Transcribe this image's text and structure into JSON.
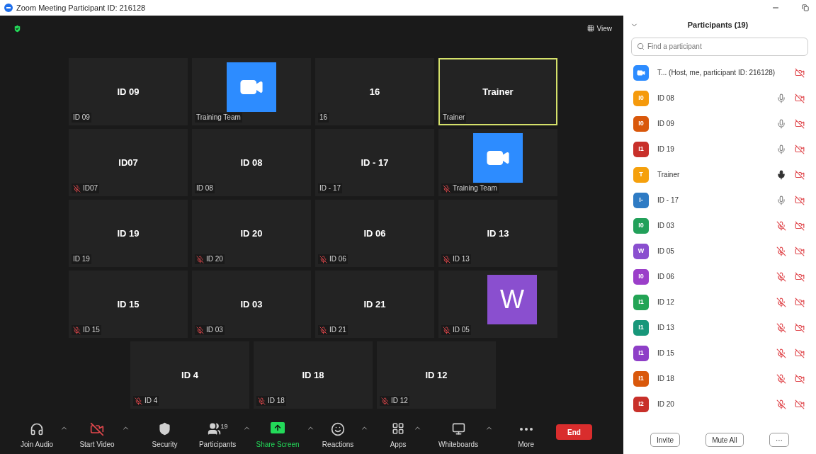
{
  "window": {
    "title": "Zoom Meeting Participant ID: 216128"
  },
  "view_button": {
    "label": "View"
  },
  "tiles": [
    {
      "kind": "name",
      "big": "ID 09",
      "label": "ID 09",
      "muted": false,
      "speaking": false
    },
    {
      "kind": "video_logo",
      "label": "Training Team",
      "muted": false,
      "speaking": false
    },
    {
      "kind": "name",
      "big": "16",
      "label": "16",
      "muted": false,
      "speaking": false
    },
    {
      "kind": "name",
      "big": "Trainer",
      "label": "Trainer",
      "muted": false,
      "speaking": true
    },
    {
      "kind": "name",
      "big": "ID07",
      "label": "ID07",
      "muted": true,
      "speaking": false
    },
    {
      "kind": "name",
      "big": "ID 08",
      "label": "ID 08",
      "muted": false,
      "speaking": false
    },
    {
      "kind": "name",
      "big": "ID - 17",
      "label": "ID - 17",
      "muted": false,
      "speaking": false
    },
    {
      "kind": "video_logo",
      "label": "Training Team",
      "muted": true,
      "speaking": false
    },
    {
      "kind": "name",
      "big": "ID 19",
      "label": "ID 19",
      "muted": false,
      "speaking": false
    },
    {
      "kind": "name",
      "big": "ID 20",
      "label": "ID 20",
      "muted": true,
      "speaking": false
    },
    {
      "kind": "name",
      "big": "ID 06",
      "label": "ID 06",
      "muted": true,
      "speaking": false
    },
    {
      "kind": "name",
      "big": "ID 13",
      "label": "ID 13",
      "muted": true,
      "speaking": false
    },
    {
      "kind": "name",
      "big": "ID 15",
      "label": "ID 15",
      "muted": true,
      "speaking": false
    },
    {
      "kind": "name",
      "big": "ID 03",
      "label": "ID 03",
      "muted": true,
      "speaking": false
    },
    {
      "kind": "name",
      "big": "ID 21",
      "label": "ID 21",
      "muted": true,
      "speaking": false
    },
    {
      "kind": "letter",
      "big": "W",
      "color": "#8a4fcf",
      "label": "ID 05",
      "muted": true,
      "speaking": false
    },
    {
      "kind": "name",
      "big": "ID 4",
      "label": "ID 4",
      "muted": true,
      "speaking": false
    },
    {
      "kind": "name",
      "big": "ID 18",
      "label": "ID 18",
      "muted": true,
      "speaking": false
    },
    {
      "kind": "name",
      "big": "ID 12",
      "label": "ID 12",
      "muted": true,
      "speaking": false
    }
  ],
  "toolbar": [
    {
      "kind": "audio",
      "label": "Join Audio",
      "caret": true,
      "highlight": false
    },
    {
      "kind": "video",
      "label": "Start Video",
      "caret": true,
      "highlight": false
    },
    {
      "kind": "security",
      "label": "Security",
      "caret": false,
      "highlight": false
    },
    {
      "kind": "participants",
      "label": "Participants",
      "count": "19",
      "caret": true,
      "highlight": false
    },
    {
      "kind": "share",
      "label": "Share Screen",
      "caret": true,
      "highlight": true
    },
    {
      "kind": "reactions",
      "label": "Reactions",
      "caret": true,
      "highlight": false
    },
    {
      "kind": "apps",
      "label": "Apps",
      "caret": true,
      "highlight": false
    },
    {
      "kind": "whiteboards",
      "label": "Whiteboards",
      "caret": true,
      "highlight": false
    },
    {
      "kind": "more",
      "label": "More",
      "caret": false,
      "highlight": false
    }
  ],
  "end_button": {
    "label": "End"
  },
  "panel": {
    "title": "Participants (19)",
    "search": {
      "placeholder": "Find a participant"
    },
    "participants": [
      {
        "kind": "host",
        "color": "#2d8cff",
        "name": "T... (Host, me, participant ID: 216128)"
      },
      {
        "kind": "member",
        "initials": "I0",
        "color": "#f59a0c",
        "name": "ID 08",
        "muted": false,
        "speaking": false
      },
      {
        "kind": "member",
        "initials": "I0",
        "color": "#d9580b",
        "name": "ID 09",
        "muted": false,
        "speaking": false
      },
      {
        "kind": "member",
        "initials": "I1",
        "color": "#c8302a",
        "name": "ID 19",
        "muted": false,
        "speaking": false
      },
      {
        "kind": "member",
        "initials": "T",
        "color": "#f5a00c",
        "name": "Trainer",
        "muted": false,
        "speaking": true
      },
      {
        "kind": "member",
        "initials": "I-",
        "color": "#2e7bc4",
        "name": "ID - 17",
        "muted": false,
        "speaking": false
      },
      {
        "kind": "member",
        "initials": "I0",
        "color": "#22a05a",
        "name": "ID 03",
        "muted": true,
        "speaking": false
      },
      {
        "kind": "member",
        "initials": "W",
        "color": "#8a4fcf",
        "name": "ID 05",
        "muted": true,
        "speaking": false
      },
      {
        "kind": "member",
        "initials": "I0",
        "color": "#9b3fc9",
        "name": "ID 06",
        "muted": true,
        "speaking": false
      },
      {
        "kind": "member",
        "initials": "I1",
        "color": "#23a455",
        "name": "ID 12",
        "muted": true,
        "speaking": false
      },
      {
        "kind": "member",
        "initials": "I1",
        "color": "#18977a",
        "name": "ID 13",
        "muted": true,
        "speaking": false
      },
      {
        "kind": "member",
        "initials": "I1",
        "color": "#8e3fc7",
        "name": "ID 15",
        "muted": true,
        "speaking": false
      },
      {
        "kind": "member",
        "initials": "I1",
        "color": "#d9580b",
        "name": "ID 18",
        "muted": true,
        "speaking": false
      },
      {
        "kind": "member",
        "initials": "I2",
        "color": "#c8302a",
        "name": "ID 20",
        "muted": true,
        "speaking": false
      }
    ],
    "buttons": [
      "Invite",
      "Mute All",
      "···"
    ]
  }
}
